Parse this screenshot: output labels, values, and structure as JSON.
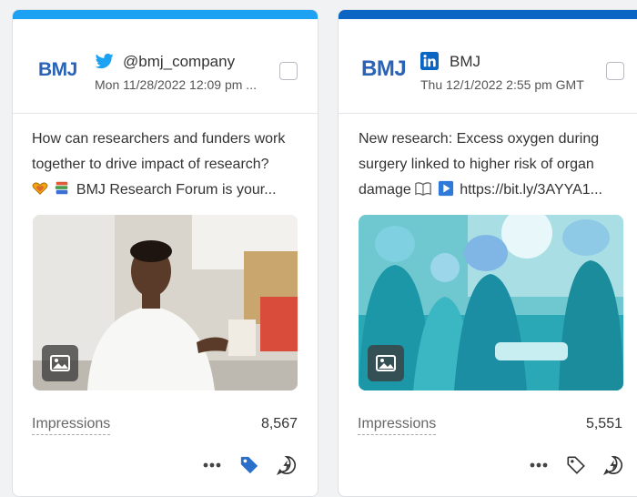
{
  "cards": [
    {
      "logo_text": "BMJ",
      "network": "twitter-icon",
      "handle": "@bmj_company",
      "date": "Mon 11/28/2022 12:09 pm ...",
      "text_lines": [
        "How can researchers and funders work",
        "together to drive impact of research?",
        "BMJ Research Forum is your..."
      ],
      "emojis": [
        "heart-hands-emoji",
        "books-emoji"
      ],
      "metric_label": "Impressions",
      "metric_value": "8,567",
      "tag_active": true,
      "accent": "#1da1f2"
    },
    {
      "logo_text": "BMJ",
      "network": "linkedin-icon",
      "handle": "BMJ",
      "date": "Thu 12/1/2022 2:55 pm GMT",
      "text_lines": [
        "New research: Excess oxygen during",
        "surgery linked to higher risk of organ",
        "damage",
        "https://bit.ly/3AYYA1..."
      ],
      "emojis": [
        "open-book-emoji",
        "play-button-emoji"
      ],
      "metric_label": "Impressions",
      "metric_value": "5,551",
      "tag_active": false,
      "accent": "#0a66c2"
    }
  ]
}
